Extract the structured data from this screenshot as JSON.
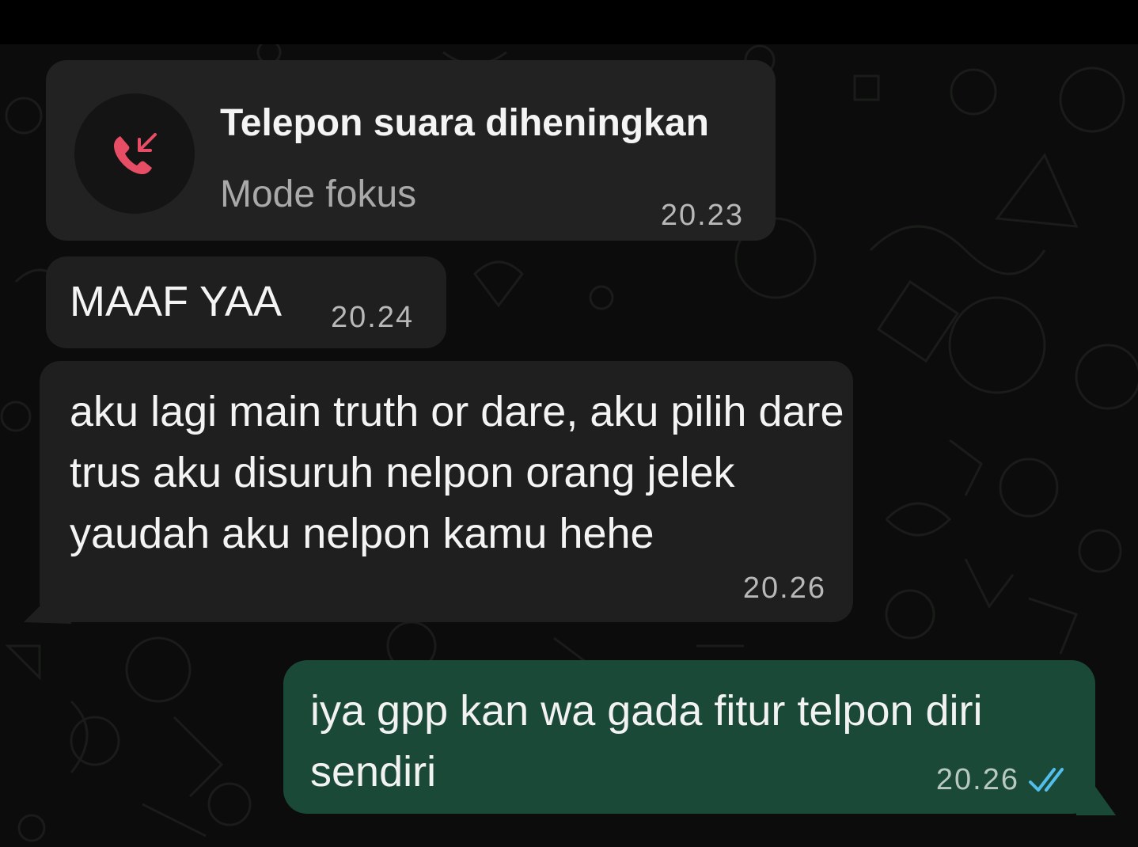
{
  "call_notice": {
    "title": "Telepon suara diheningkan",
    "subtitle": "Mode fokus",
    "time": "20.23",
    "icon": "missed-call-phone-icon",
    "icon_color": "#e84d66"
  },
  "messages": [
    {
      "direction": "incoming",
      "text": "MAAF YAA",
      "time": "20.24"
    },
    {
      "direction": "incoming",
      "text": "aku lagi main truth or dare, aku pilih dare trus aku disuruh nelpon orang jelek yaudah aku nelpon kamu hehe",
      "time": "20.26"
    },
    {
      "direction": "outgoing",
      "text": "iya gpp kan wa gada fitur telpon diri sendiri",
      "time": "20.26",
      "status": "read",
      "status_icon": "double-check-icon"
    }
  ],
  "colors": {
    "background": "#0b0c0b",
    "incoming_bubble": "#1f1f1f",
    "outgoing_bubble": "#1a4a37",
    "read_ticks": "#53bdeb"
  }
}
